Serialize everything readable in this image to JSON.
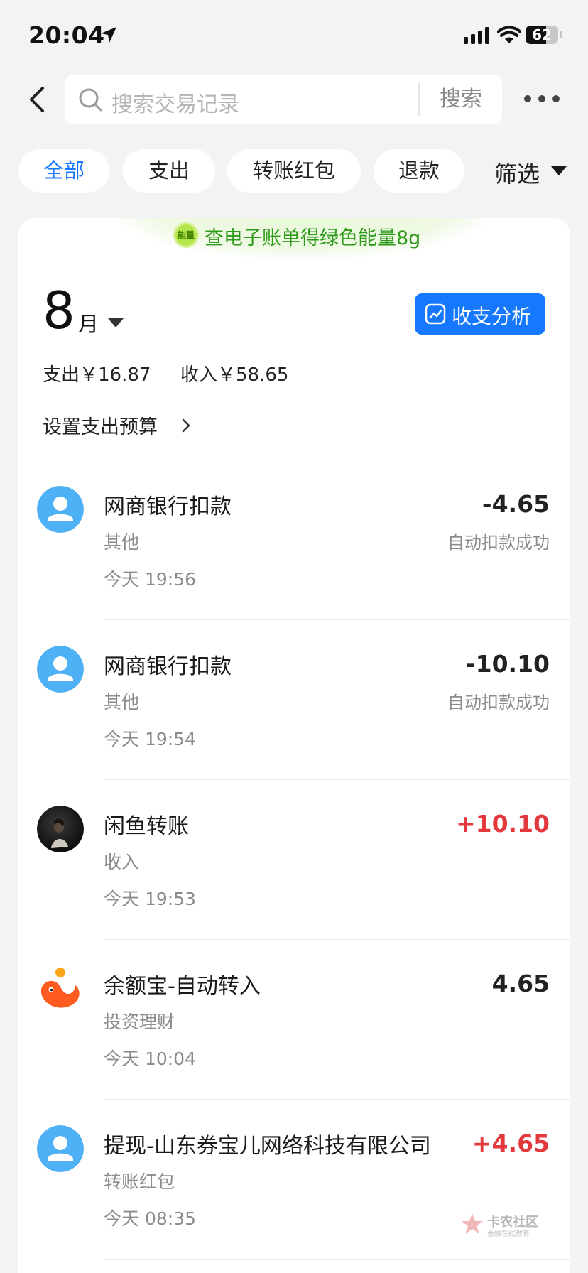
{
  "status_bar": {
    "time": "20:04",
    "battery": "62",
    "battery_level": 0.62
  },
  "search": {
    "placeholder": "搜索交易记录",
    "button_label": "搜索"
  },
  "filters": {
    "chips": [
      "全部",
      "支出",
      "转账红包",
      "退款"
    ],
    "active_index": 0,
    "filter_label": "筛选"
  },
  "energy_banner": {
    "badge": "能量",
    "text": "查电子账单得绿色能量8g",
    "color": "#2f9a1c"
  },
  "month": {
    "number": "8",
    "unit": "月",
    "analysis_label": "收支分析",
    "expense": "支出￥16.87",
    "income": "收入￥58.65",
    "budget_label": "设置支出预算"
  },
  "transactions": [
    {
      "name": "网商银行扣款",
      "category": "其他",
      "time": "今天 19:56",
      "amount": "-4.65",
      "status": "自动扣款成功",
      "avatar": "default-user-icon"
    },
    {
      "name": "网商银行扣款",
      "category": "其他",
      "time": "今天 19:54",
      "amount": "-10.10",
      "status": "自动扣款成功",
      "avatar": "default-user-icon"
    },
    {
      "name": "闲鱼转账",
      "category": "收入",
      "time": "今天 19:53",
      "amount": "+10.10",
      "status": "",
      "avatar": "photo-avatar"
    },
    {
      "name": "余额宝-自动转入",
      "category": "投资理财",
      "time": "今天 10:04",
      "amount": "4.65",
      "status": "",
      "avatar": "yuebao-icon"
    },
    {
      "name": "提现-山东券宝儿网络科技有限公司",
      "category": "转账红包",
      "time": "今天 08:35",
      "amount": "+4.65",
      "status": "",
      "avatar": "default-user-icon"
    }
  ],
  "colors": {
    "accent": "#1677ff",
    "income": "#e4393c",
    "avatar_blue": "#4fb1f5",
    "yuebao_orange": "#ff5a1f"
  },
  "watermark": {
    "title": "卡农社区",
    "subtitle": "金融在线教育"
  }
}
